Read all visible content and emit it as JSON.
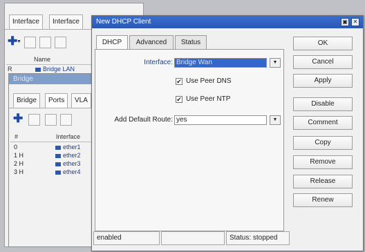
{
  "background": {
    "tabs": [
      "Interface",
      "Interface"
    ],
    "list_header": "Name",
    "list_row": "Bridge LAN",
    "list_row_prefix": "R"
  },
  "bridge": {
    "title": "Bridge",
    "tabs": [
      "Bridge",
      "Ports",
      "VLA"
    ],
    "columns": [
      "#",
      "Interface"
    ],
    "rows": [
      {
        "num": "0",
        "iface": "ether1"
      },
      {
        "num": "1 H",
        "iface": "ether2"
      },
      {
        "num": "2 H",
        "iface": "ether3"
      },
      {
        "num": "3 H",
        "iface": "ether4"
      }
    ]
  },
  "dialog": {
    "title": "New DHCP Client",
    "tabs": [
      "DHCP",
      "Advanced",
      "Status"
    ],
    "interface_label": "Interface:",
    "interface_value": "Bridge Wan",
    "use_peer_dns_label": "Use Peer DNS",
    "use_peer_ntp_label": "Use Peer NTP",
    "add_default_route_label": "Add Default Route:",
    "add_default_route_value": "yes",
    "buttons": [
      "OK",
      "Cancel",
      "Apply",
      "Disable",
      "Comment",
      "Copy",
      "Remove",
      "Release",
      "Renew"
    ],
    "status_left": "enabled",
    "status_right": "Status: stopped"
  },
  "colors": {
    "title_bar": "#2f62c4",
    "selection": "#3367cc"
  }
}
